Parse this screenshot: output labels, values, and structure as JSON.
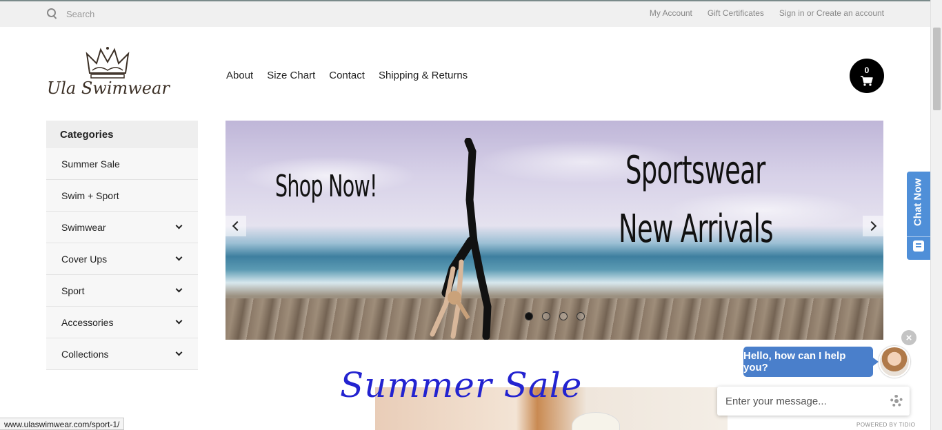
{
  "search": {
    "placeholder": "Search"
  },
  "toplinks": {
    "account": "My Account",
    "gift": "Gift Certificates",
    "signin": "Sign in or Create an account"
  },
  "logo": {
    "text": "Ula Swimwear"
  },
  "nav": {
    "about": "About",
    "size_chart": "Size Chart",
    "contact": "Contact",
    "shipping": "Shipping & Returns"
  },
  "cart": {
    "count": "0"
  },
  "categories": {
    "title": "Categories",
    "items": [
      {
        "label": "Summer Sale",
        "expandable": false
      },
      {
        "label": "Swim + Sport",
        "expandable": false
      },
      {
        "label": "Swimwear",
        "expandable": true
      },
      {
        "label": "Cover Ups",
        "expandable": true
      },
      {
        "label": "Sport",
        "expandable": true
      },
      {
        "label": "Accessories",
        "expandable": true
      },
      {
        "label": "Collections",
        "expandable": true
      }
    ]
  },
  "hero": {
    "shop_now": "Shop Now!",
    "line1": "Sportswear",
    "line2": "New Arrivals",
    "active_slide": 1,
    "slide_count": 4
  },
  "banner": {
    "title": "Summer Sale"
  },
  "chat": {
    "tab_label": "Chat Now",
    "greeting": "Hello, how can I help you?",
    "input_placeholder": "Enter your message...",
    "powered_by": "POWERED BY TIDIO",
    "close": "×"
  },
  "status": {
    "url": "www.ulaswimwear.com/sport-1/"
  },
  "colors": {
    "chat_blue": "#4a7fcb",
    "sale_blue": "#2323d0",
    "cart_bg": "#000000"
  }
}
